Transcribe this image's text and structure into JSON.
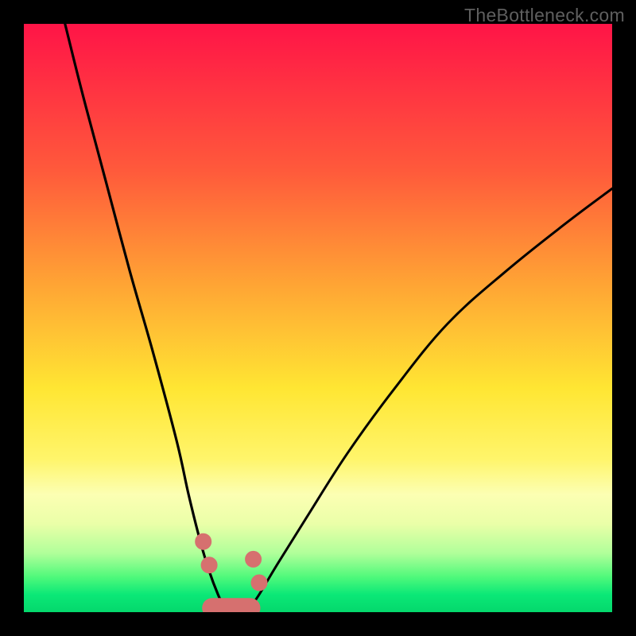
{
  "watermark": "TheBottleneck.com",
  "colors": {
    "frame": "#000000",
    "gradient_top": "#ff1447",
    "gradient_bottom": "#04d86c",
    "curve_stroke": "#000000",
    "marker_fill": "#d6706f",
    "marker_stroke": "#d6706f"
  },
  "chart_data": {
    "type": "line",
    "title": "",
    "xlabel": "",
    "ylabel": "",
    "xlim": [
      0,
      100
    ],
    "ylim": [
      0,
      100
    ],
    "x_optimal": 35,
    "left_curve": {
      "description": "Steep descending curve from top-left toward valley",
      "x": [
        7,
        10,
        14,
        18,
        22,
        26,
        28,
        30,
        31.5,
        33,
        34,
        35
      ],
      "y": [
        100,
        88,
        73,
        58,
        44,
        29,
        20,
        12,
        7,
        3,
        1,
        0
      ]
    },
    "right_curve": {
      "description": "Rising curve from valley toward upper-right",
      "x": [
        37,
        38.5,
        40,
        43,
        48,
        55,
        63,
        72,
        82,
        92,
        100
      ],
      "y": [
        0,
        1,
        3,
        8,
        16,
        27,
        38,
        49,
        58,
        66,
        72
      ]
    },
    "valley_plateau": {
      "description": "Flat bottom segment between the two curves",
      "x": [
        35,
        36,
        37
      ],
      "y": [
        0,
        0,
        0
      ]
    },
    "markers": {
      "description": "Pink/salmon dots and floor band near the valley",
      "points": [
        {
          "x": 30.5,
          "y": 12
        },
        {
          "x": 31.5,
          "y": 8
        },
        {
          "x": 39.0,
          "y": 9
        },
        {
          "x": 40.0,
          "y": 5
        }
      ],
      "floor_band": {
        "x_start": 32,
        "x_end": 38.5,
        "y": 0.7,
        "thickness": 3.4
      }
    }
  }
}
